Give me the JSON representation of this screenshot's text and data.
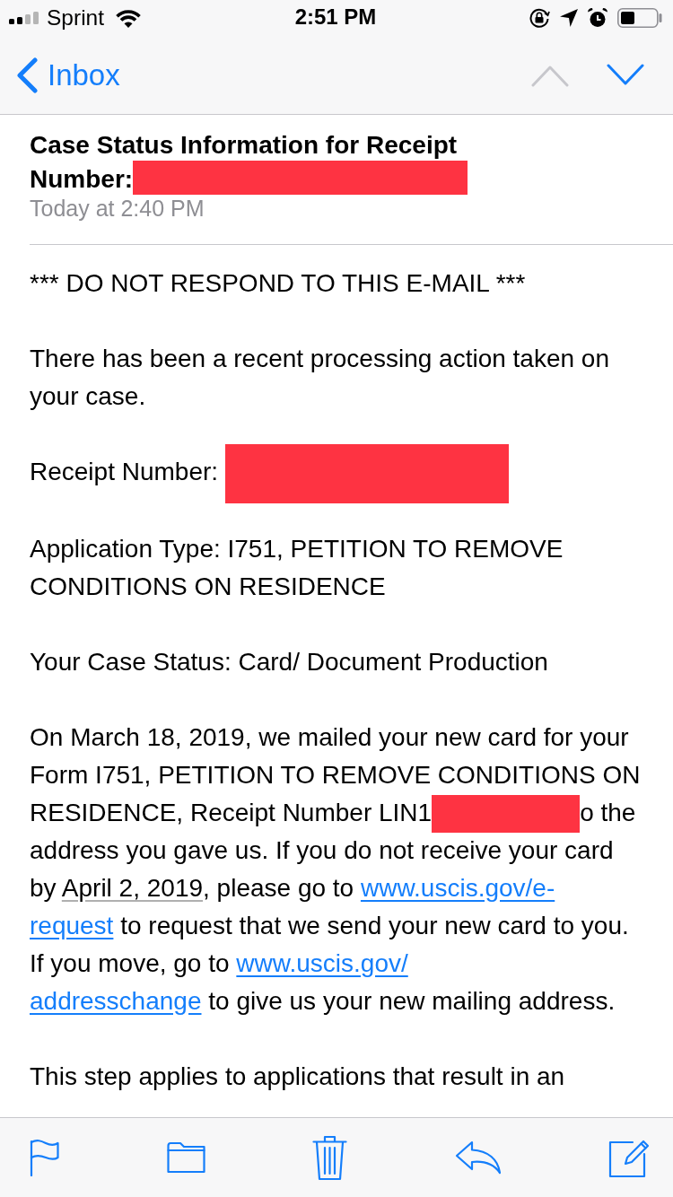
{
  "status_bar": {
    "carrier": "Sprint",
    "time": "2:51 PM"
  },
  "navigation": {
    "back_label": "Inbox",
    "arrows": [
      {
        "kind": "up",
        "disabled": true
      },
      {
        "kind": "down",
        "disabled": false
      }
    ]
  },
  "message": {
    "subject": [
      {
        "kind": "text",
        "text": "Case Status Information for Receipt Number:"
      },
      {
        "kind": "redaction"
      }
    ],
    "date": "Today at 2:40 PM",
    "body": [
      {
        "segments": [
          {
            "kind": "text",
            "text": "*** DO NOT RESPOND TO THIS E-MAIL ***"
          }
        ]
      },
      {
        "segments": [
          {
            "kind": "text",
            "text": "There has been a recent processing action taken on your case."
          }
        ]
      },
      {
        "segments": [
          {
            "kind": "text",
            "text": "Receipt Number: "
          },
          {
            "kind": "redaction"
          }
        ]
      },
      {
        "segments": [
          {
            "kind": "text",
            "text": "Application Type: I751, PETITION TO REMOVE CONDITIONS ON RESIDENCE"
          }
        ]
      },
      {
        "segments": [
          {
            "kind": "text",
            "text": "Your Case Status: Card/ Document Production"
          }
        ]
      },
      {
        "segments": [
          {
            "kind": "text",
            "text": "On March 18, 2019, we mailed your new card for your Form I751, PETITION TO REMOVE CONDITIONS ON RESIDENCE, Receipt Number LIN1"
          },
          {
            "kind": "redaction"
          },
          {
            "kind": "text",
            "text": "o the address you gave us. If you do not receive your card by "
          },
          {
            "kind": "date",
            "text": "April 2, 2019"
          },
          {
            "kind": "text",
            "text": ", please go to "
          },
          {
            "kind": "link",
            "text": "www.uscis.gov/e-"
          },
          {
            "kind": "link",
            "text": "request"
          },
          {
            "kind": "text",
            "text": " to request that we send your new card to you. If you move, go to "
          },
          {
            "kind": "link",
            "text": "www.uscis.gov/"
          },
          {
            "kind": "link",
            "text": "addresschange"
          },
          {
            "kind": "text",
            "text": " to give us your new mailing address."
          }
        ]
      },
      {
        "segments": [
          {
            "kind": "text",
            "text": "This step applies to applications that result in an"
          }
        ]
      }
    ]
  }
}
